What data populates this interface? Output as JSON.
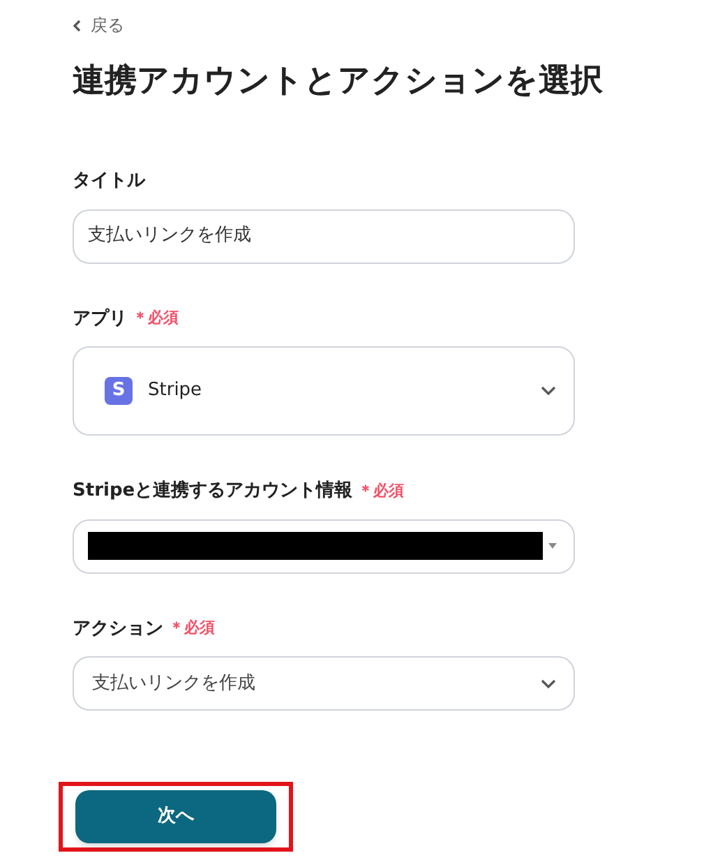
{
  "back_link": {
    "label": "戻る"
  },
  "title": "連携アカウントとアクションを選択",
  "fields": [
    {
      "kind": "text",
      "label": "タイトル",
      "value": "支払いリンクを作成"
    },
    {
      "kind": "app",
      "label": "アプリ",
      "required_mark": "＊",
      "required_text": "必須",
      "value": "Stripe",
      "app_icon_letter": "S"
    },
    {
      "kind": "redacted",
      "label": "Stripeと連携するアカウント情報",
      "required_mark": "＊",
      "required_text": "必須"
    },
    {
      "kind": "select",
      "label": "アクション",
      "required_mark": "＊",
      "required_text": "必須",
      "value": "支払いリンクを作成"
    }
  ],
  "next_button": {
    "label": "次へ",
    "highlighted": true
  }
}
